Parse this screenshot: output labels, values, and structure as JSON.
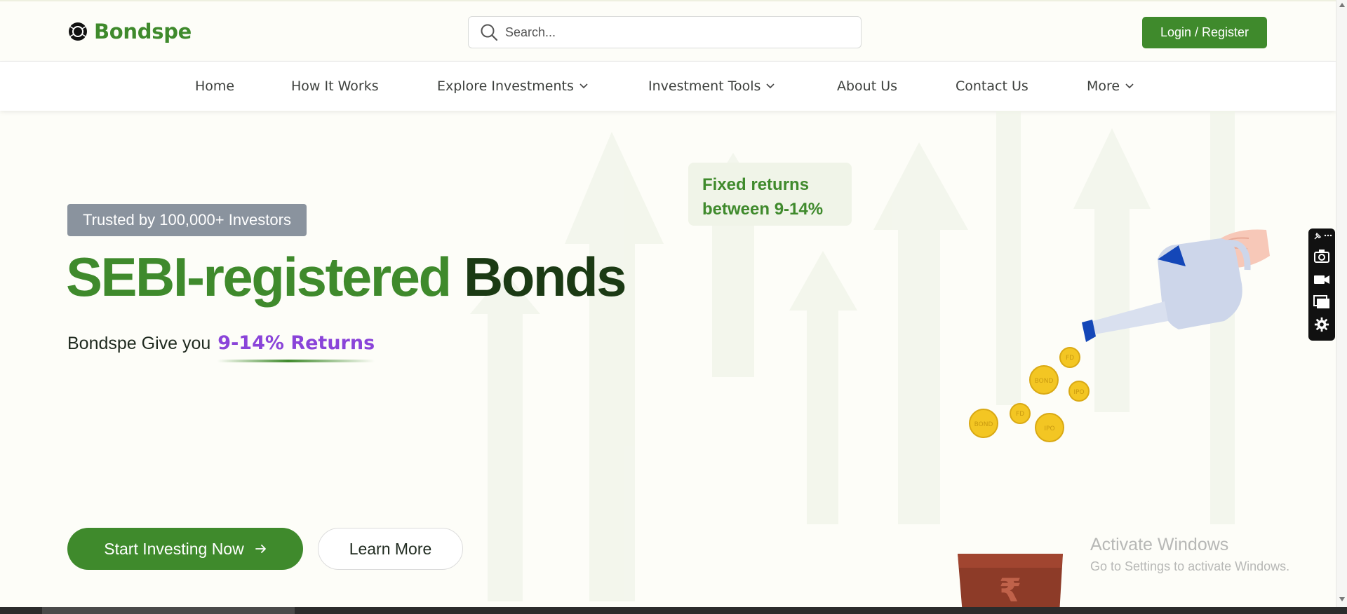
{
  "brand": {
    "name": "Bondspe",
    "logo_icon": "bondspe-logo-icon",
    "accent_color": "#3f8a2c",
    "highlight_color": "#8a44d9"
  },
  "search": {
    "placeholder": "Search...",
    "icon": "search-icon"
  },
  "header": {
    "login_label": "Login / Register"
  },
  "nav": {
    "items": [
      {
        "label": "Home",
        "has_dropdown": false
      },
      {
        "label": "How It Works",
        "has_dropdown": false
      },
      {
        "label": "Explore Investments",
        "has_dropdown": true
      },
      {
        "label": "Investment Tools",
        "has_dropdown": true
      },
      {
        "label": "About Us",
        "has_dropdown": false
      },
      {
        "label": "Contact Us",
        "has_dropdown": false
      },
      {
        "label": "More",
        "has_dropdown": true
      }
    ]
  },
  "hero": {
    "badge": "Trusted by 100,000+ Investors",
    "headline_part1": "SEBI-registered",
    "headline_part2": "Bonds",
    "subline_prefix": "Bondspe Give you",
    "subline_highlight": "9-14% Returns",
    "fixed_card_line1": "Fixed returns",
    "fixed_card_line2": "between 9-14%",
    "primary_cta": "Start Investing Now",
    "primary_cta_icon": "arrow-right-icon",
    "secondary_cta": "Learn More",
    "coin_labels": [
      "FD",
      "BOND",
      "IPO",
      "BOND",
      "FD",
      "IPO"
    ]
  },
  "system": {
    "watermark_title": "Activate Windows",
    "watermark_subtitle": "Go to Settings to activate Windows.",
    "side_toolbar_icons": [
      "pin-icon",
      "more-icon",
      "camera-icon",
      "video-icon",
      "window-icon",
      "settings-icon"
    ]
  }
}
